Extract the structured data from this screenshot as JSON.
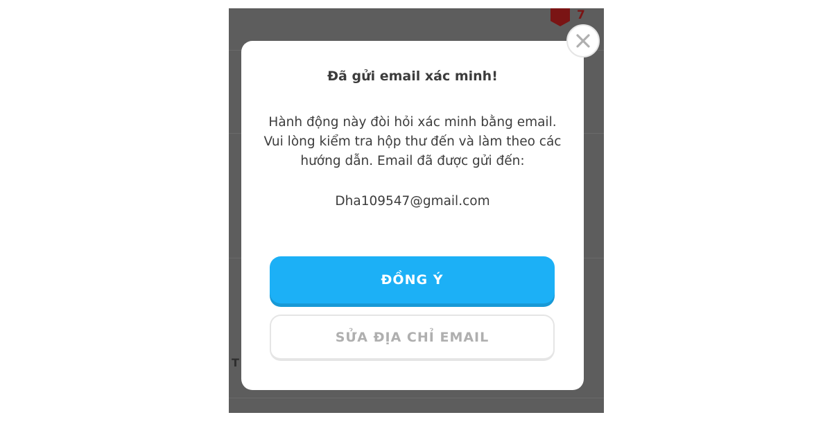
{
  "background": {
    "gem_count": "7",
    "partial_text": "T"
  },
  "dialog": {
    "title": "Đã gửi email xác minh!",
    "message_line1": "Hành động này đòi hỏi xác minh bằng email.",
    "message_line2": "Vui lòng kiểm tra hộp thư đến và làm theo các",
    "message_line3": "hướng dẫn. Email đã được gửi đến:",
    "email": "Dha109547@gmail.com",
    "primary_button": "ĐỒNG Ý",
    "secondary_button": "SỬA ĐỊA CHỈ EMAIL",
    "close_icon": "close-icon"
  },
  "colors": {
    "primary": "#1cb0f6",
    "primary_shadow": "#1899d6",
    "overlay": "#5d5d5d",
    "text": "#3c3c3c",
    "secondary_text": "#afafaf",
    "gem": "#7a1414"
  }
}
